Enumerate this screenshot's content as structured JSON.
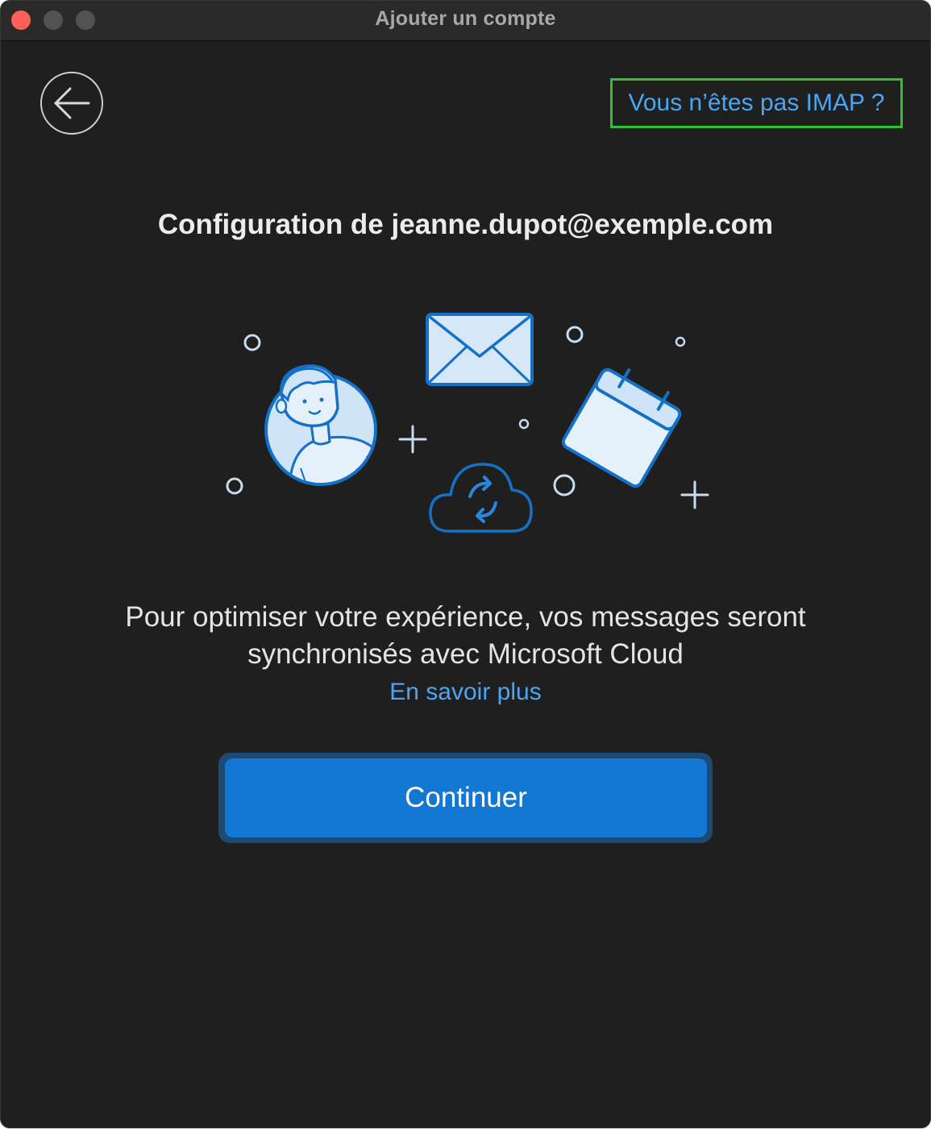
{
  "window": {
    "title": "Ajouter un compte"
  },
  "header": {
    "imap_link": "Vous n’êtes pas IMAP ?"
  },
  "main": {
    "heading": "Configuration de jeanne.dupot@exemple.com",
    "message": "Pour optimiser votre expérience, vos messages seront synchronisés avec Microsoft Cloud",
    "learn_more": "En savoir plus",
    "continue_label": "Continuer"
  },
  "icons": {
    "back": "arrow-left-icon",
    "illustration": [
      "person-avatar-icon",
      "envelope-icon",
      "calendar-icon",
      "cloud-sync-icon"
    ]
  },
  "colors": {
    "background": "#1f1f1f",
    "link": "#4aa6f2",
    "primary_button": "#1378d4",
    "highlight_border": "#2ec22e"
  }
}
